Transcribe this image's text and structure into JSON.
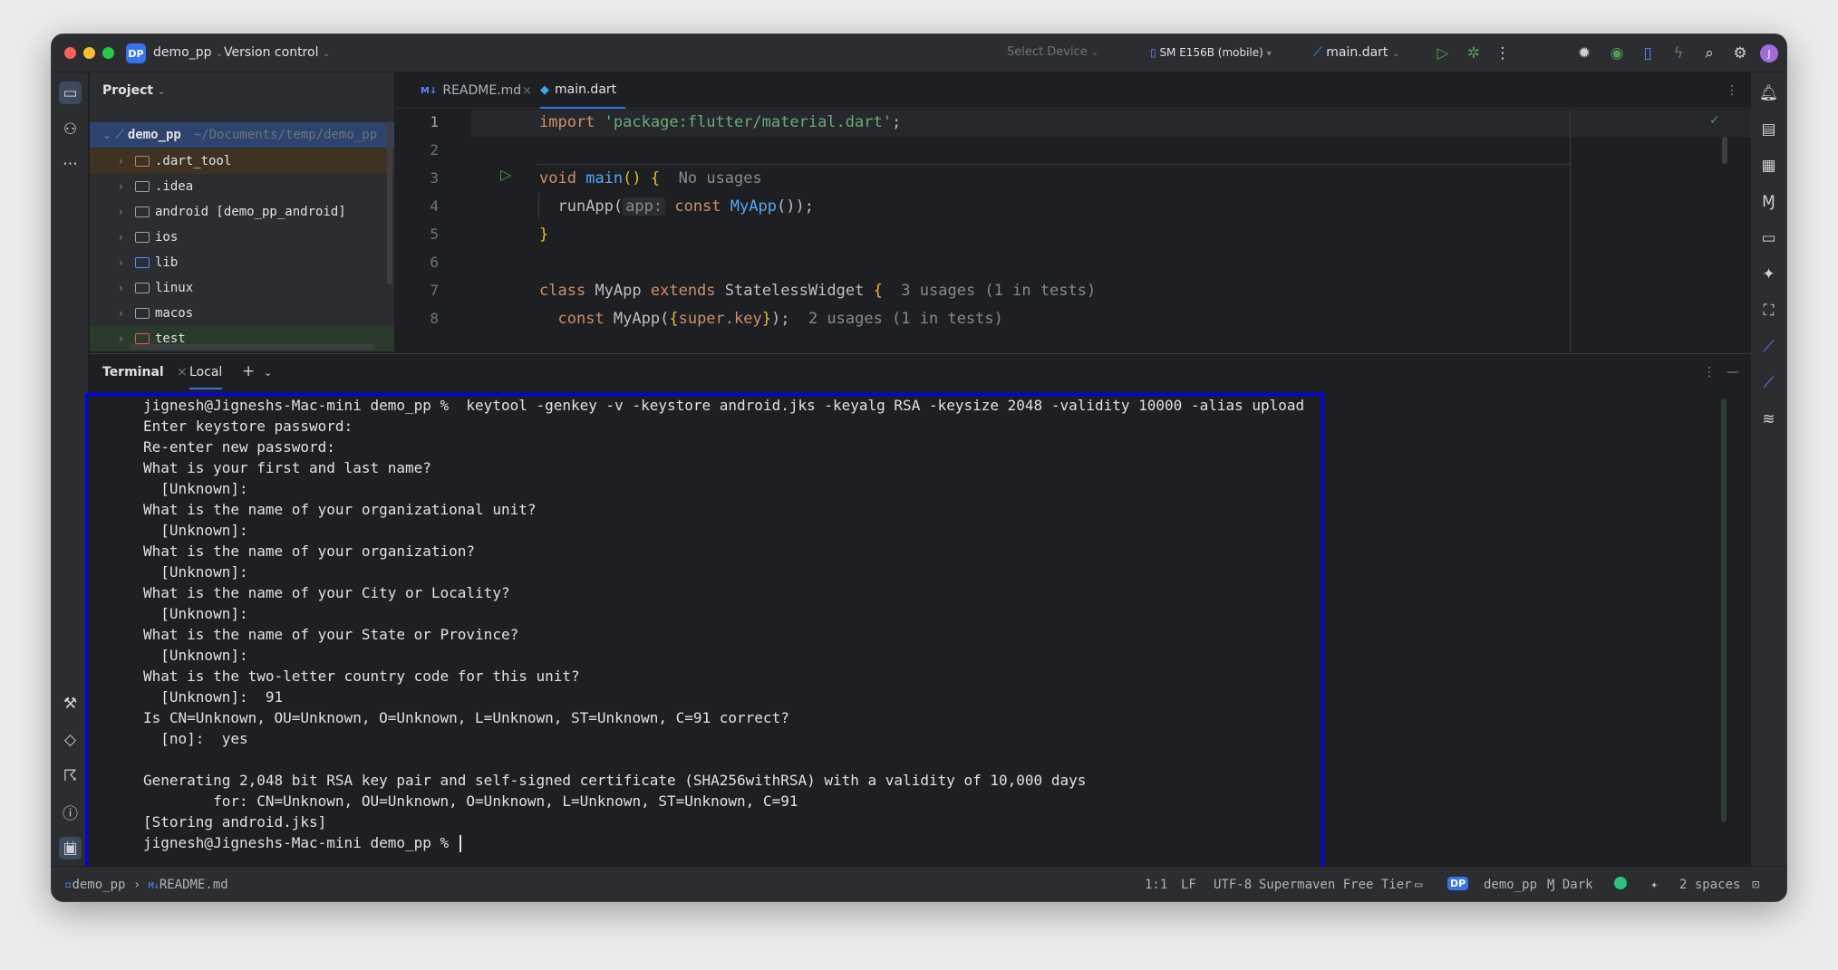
{
  "titlebar": {
    "project_badge": "DP",
    "project_name": "demo_pp",
    "vcs_label": "Version control",
    "device_placeholder": "Select Device",
    "device_name": "SM E156B (mobile)",
    "run_config": "main.dart"
  },
  "project_panel": {
    "header": "Project",
    "root_name": "demo_pp",
    "root_path": "~/Documents/temp/demo_pp",
    "items": [
      {
        "label": ".dart_tool"
      },
      {
        "label": ".idea"
      },
      {
        "label": "android [demo_pp_android]"
      },
      {
        "label": "ios"
      },
      {
        "label": "lib"
      },
      {
        "label": "linux"
      },
      {
        "label": "macos"
      },
      {
        "label": "test"
      }
    ]
  },
  "editor": {
    "tabs": [
      {
        "badge": "M↓",
        "label": "README.md"
      },
      {
        "label": "main.dart"
      }
    ],
    "line_numbers": [
      "1",
      "2",
      "3",
      "4",
      "5",
      "6",
      "7",
      "8"
    ],
    "line1": {
      "kw": "import",
      "str": "'package:flutter/material.dart'",
      "end": ";"
    },
    "line3": {
      "kw": "void",
      "fn": "main",
      "paren": "()",
      "brace": "{",
      "hint": "No usages"
    },
    "line4": {
      "call": "runApp(",
      "inlay": "app:",
      "kw": "const",
      "cls": "MyApp",
      "end": "());"
    },
    "line5": {
      "brace": "}"
    },
    "line7": {
      "kw1": "class",
      "name": "MyApp",
      "kw2": "extends",
      "sup": "StatelessWidget",
      "brace": "{",
      "hint": "3 usages (1 in tests)"
    },
    "line8": {
      "kw": "const",
      "name": "MyApp(",
      "brace_open": "{",
      "param": "super.key",
      "brace_close": "}",
      "end": ");",
      "hint": "2 usages (1 in tests)"
    }
  },
  "terminal": {
    "title": "Terminal",
    "tab_label": "Local",
    "lines": [
      "jignesh@Jigneshs-Mac-mini demo_pp %  keytool -genkey -v -keystore android.jks -keyalg RSA -keysize 2048 -validity 10000 -alias upload",
      "Enter keystore password:",
      "Re-enter new password:",
      "What is your first and last name?",
      "  [Unknown]:",
      "What is the name of your organizational unit?",
      "  [Unknown]:",
      "What is the name of your organization?",
      "  [Unknown]:",
      "What is the name of your City or Locality?",
      "  [Unknown]:",
      "What is the name of your State or Province?",
      "  [Unknown]:",
      "What is the two-letter country code for this unit?",
      "  [Unknown]:  91",
      "Is CN=Unknown, OU=Unknown, O=Unknown, L=Unknown, ST=Unknown, C=91 correct?",
      "  [no]:  yes",
      "",
      "Generating 2,048 bit RSA key pair and self-signed certificate (SHA256withRSA) with a validity of 10,000 days",
      "\tfor: CN=Unknown, OU=Unknown, O=Unknown, L=Unknown, ST=Unknown, C=91",
      "[Storing android.jks]"
    ],
    "prompt": "jignesh@Jigneshs-Mac-mini demo_pp % "
  },
  "statusbar": {
    "breadcrumb_project": "demo_pp",
    "breadcrumb_badge": "M↓",
    "breadcrumb_file": "README.md",
    "position": "1:1",
    "line_sep": "LF",
    "encoding": "UTF-8",
    "plugin": "Supermaven Free Tier",
    "project_badge": "DP",
    "project_name": "demo_pp",
    "theme": "Dark",
    "indent": "2 spaces"
  },
  "colors": {
    "accent": "#3574f0",
    "highlight_box": "#0000ff"
  }
}
